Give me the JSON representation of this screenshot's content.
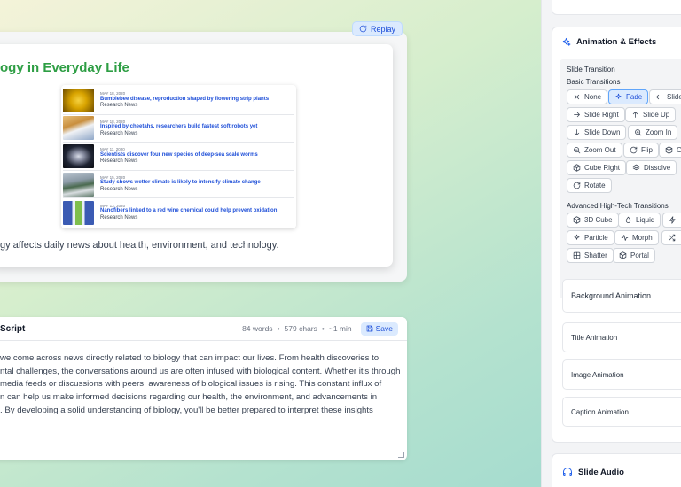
{
  "preview": {
    "replay_label": "Replay",
    "slide": {
      "title": "ogy in Everyday Life",
      "caption": "gy affects daily news about health, environment, and technology.",
      "news": [
        {
          "date": "MAY 18, 2020",
          "headline": "Bumblebee disease, reproduction shaped by flowering strip plants",
          "source": "Research News",
          "thumb_color": "#d9a400"
        },
        {
          "date": "MAY 18, 2020",
          "headline": "Inspired by cheetahs, researchers build fastest soft robots yet",
          "source": "Research News",
          "thumb_color": "#8fa7c8"
        },
        {
          "date": "MAY 11, 2020",
          "headline": "Scientists discover four new species of deep-sea scale worms",
          "source": "Research News",
          "thumb_color": "#1f2433"
        },
        {
          "date": "MAY 15, 2020",
          "headline": "Study shows wetter climate is likely to intensify climate change",
          "source": "Research News",
          "thumb_color": "#5f7a6a"
        },
        {
          "date": "MAY 13, 2020",
          "headline": "Nanofibers linked to a red wine chemical could help prevent oxidation",
          "source": "Research News",
          "thumb_color": "#3b5bb3"
        }
      ]
    }
  },
  "script": {
    "title": "Script",
    "words": "84 words",
    "chars": "579 chars",
    "duration": "~1 min",
    "save_label": "Save",
    "lines": [
      "we come across news directly related to biology that can impact our lives. From health discoveries to",
      "ntal challenges, the conversations around us are often infused with biological content. Whether it's through",
      "media feeds or discussions with peers, awareness of biological issues is rising. This constant influx of",
      "n can help us make informed decisions regarding our health, the environment, and advancements in",
      ". By developing a solid understanding of biology, you'll be better prepared to interpret these insights"
    ]
  },
  "sidebar": {
    "animation": {
      "title": "Animation & Effects",
      "section_label": "Slide Transition",
      "basic_label": "Basic Transitions",
      "advanced_label": "Advanced High-Tech Transitions",
      "basic": [
        {
          "label": "None",
          "icon": "x-icon"
        },
        {
          "label": "Fade",
          "icon": "sparkle-icon",
          "active": true
        },
        {
          "label": "Slide",
          "icon": "arrow-left-icon"
        },
        {
          "label": "Slide Right",
          "icon": "arrow-right-icon"
        },
        {
          "label": "Slide Up",
          "icon": "arrow-up-icon"
        },
        {
          "label": "Slide Down",
          "icon": "arrow-down-icon"
        },
        {
          "label": "Zoom In",
          "icon": "zoom-in-icon"
        },
        {
          "label": "Zoom Out",
          "icon": "zoom-out-icon"
        },
        {
          "label": "Flip",
          "icon": "rotate-icon"
        },
        {
          "label": "C",
          "icon": "cube-icon"
        },
        {
          "label": "Cube Right",
          "icon": "cube-icon"
        },
        {
          "label": "Dissolve",
          "icon": "layers-icon"
        },
        {
          "label": "Rotate",
          "icon": "rotate-icon"
        }
      ],
      "advanced": [
        {
          "label": "3D Cube",
          "icon": "cube-icon"
        },
        {
          "label": "Liquid",
          "icon": "droplet-icon"
        },
        {
          "label": "",
          "icon": "bolt-icon"
        },
        {
          "label": "Particle",
          "icon": "sparkle-icon"
        },
        {
          "label": "Morph",
          "icon": "wave-icon"
        },
        {
          "label": "",
          "icon": "shuffle-icon"
        },
        {
          "label": "Shatter",
          "icon": "grid-icon"
        },
        {
          "label": "Portal",
          "icon": "cube-icon"
        }
      ]
    },
    "sub_sections": [
      "Background Animation",
      "Title Animation",
      "Image Animation",
      "Caption Animation"
    ],
    "audio_title": "Slide Audio"
  }
}
